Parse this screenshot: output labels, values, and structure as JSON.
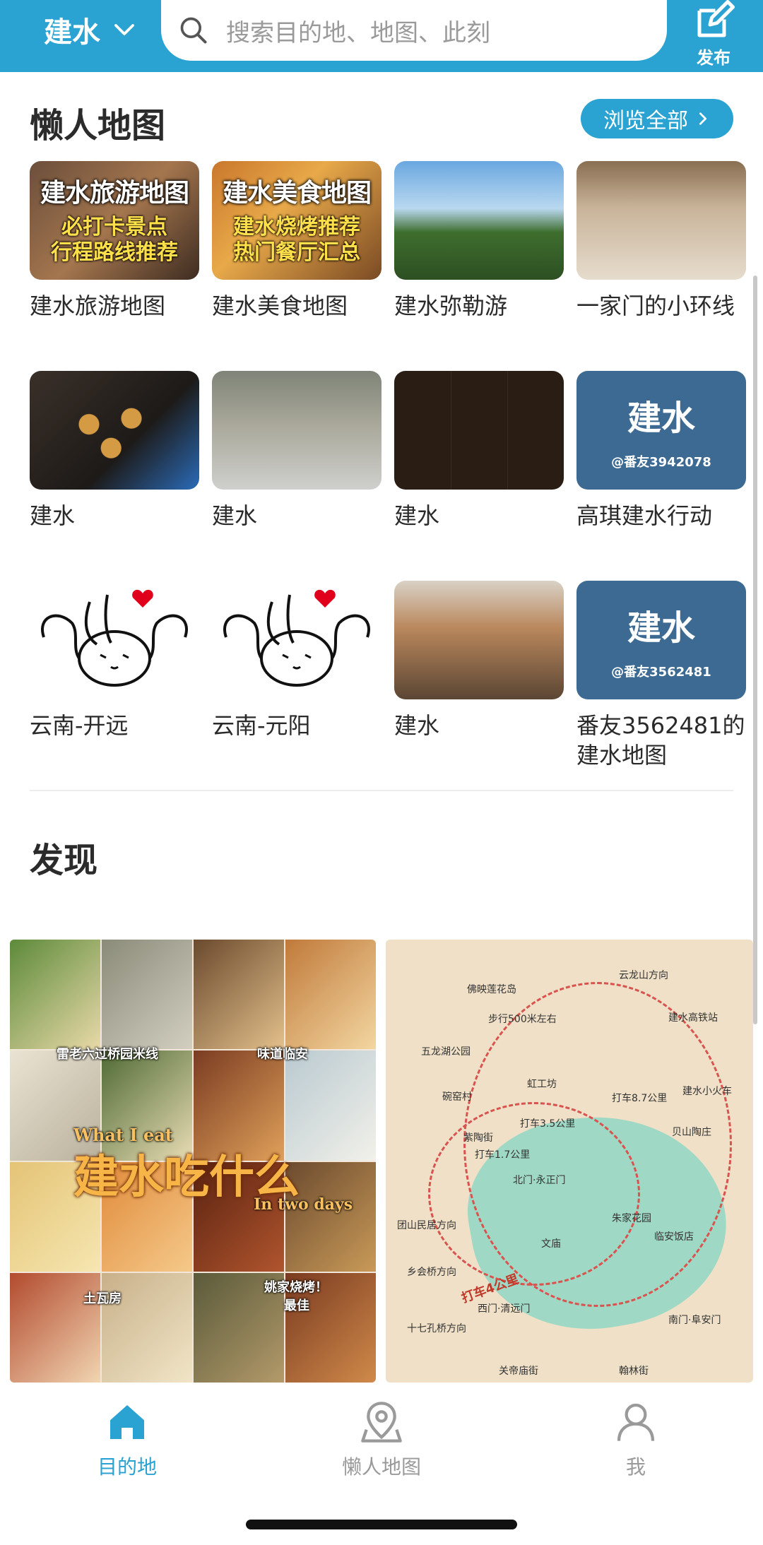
{
  "header": {
    "city": "建水",
    "search_placeholder": "搜索目的地、地图、此刻",
    "publish_label": "发布",
    "brand_color": "#2aa3d3"
  },
  "lazy_maps": {
    "title": "懒人地图",
    "browse_all": "浏览全部",
    "items": [
      {
        "name": "建水旅游地图",
        "thumb_title": "建水旅游地图",
        "thumb_sub": "必打卡景点\n行程路线推荐"
      },
      {
        "name": "建水美食地图",
        "thumb_title": "建水美食地图",
        "thumb_sub": "建水烧烤推荐\n热门餐厅汇总"
      },
      {
        "name": "建水弥勒游"
      },
      {
        "name": "一家门的小环线"
      },
      {
        "name": "建水"
      },
      {
        "name": "建水"
      },
      {
        "name": "建水"
      },
      {
        "name": "高琪建水行动",
        "thumb_title": "建水",
        "thumb_sub": "@番友3942078"
      },
      {
        "name": "云南-开远"
      },
      {
        "name": "云南-元阳"
      },
      {
        "name": "建水"
      },
      {
        "name": "番友3562481的建水地图",
        "thumb_title": "建水",
        "thumb_sub": "@番友3562481"
      }
    ]
  },
  "discover": {
    "title": "发现",
    "card_a": {
      "big": "建水吃什么",
      "what": "What I eat",
      "two": "In two days",
      "tag1": "雷老六过桥园米线",
      "tag2": "味道临安",
      "tag3": "土瓦房",
      "tag4": "姚家烧烤！",
      "tag5": "最佳"
    },
    "card_b": {
      "labels": [
        "云龙山方向",
        "佛映莲花岛",
        "步行500米左右",
        "建水高铁站",
        "五龙湖公园",
        "碗窑村",
        "虹工坊",
        "建水小火车",
        "打车8.7公里",
        "打车3.5公里",
        "紫陶街",
        "打车1.7公里",
        "贝山陶庄",
        "北门·永正门",
        "团山民居方向",
        "乡会桥方向",
        "打车4公里",
        "西门·清远门",
        "十七孔桥方向",
        "南门·阜安门",
        "文庙",
        "朱家花园",
        "临安饭店",
        "翰林街",
        "关帝庙街"
      ]
    }
  },
  "bottom_nav": {
    "items": [
      {
        "label": "目的地",
        "active": true
      },
      {
        "label": "懒人地图",
        "active": false
      },
      {
        "label": "我",
        "active": false
      }
    ]
  }
}
